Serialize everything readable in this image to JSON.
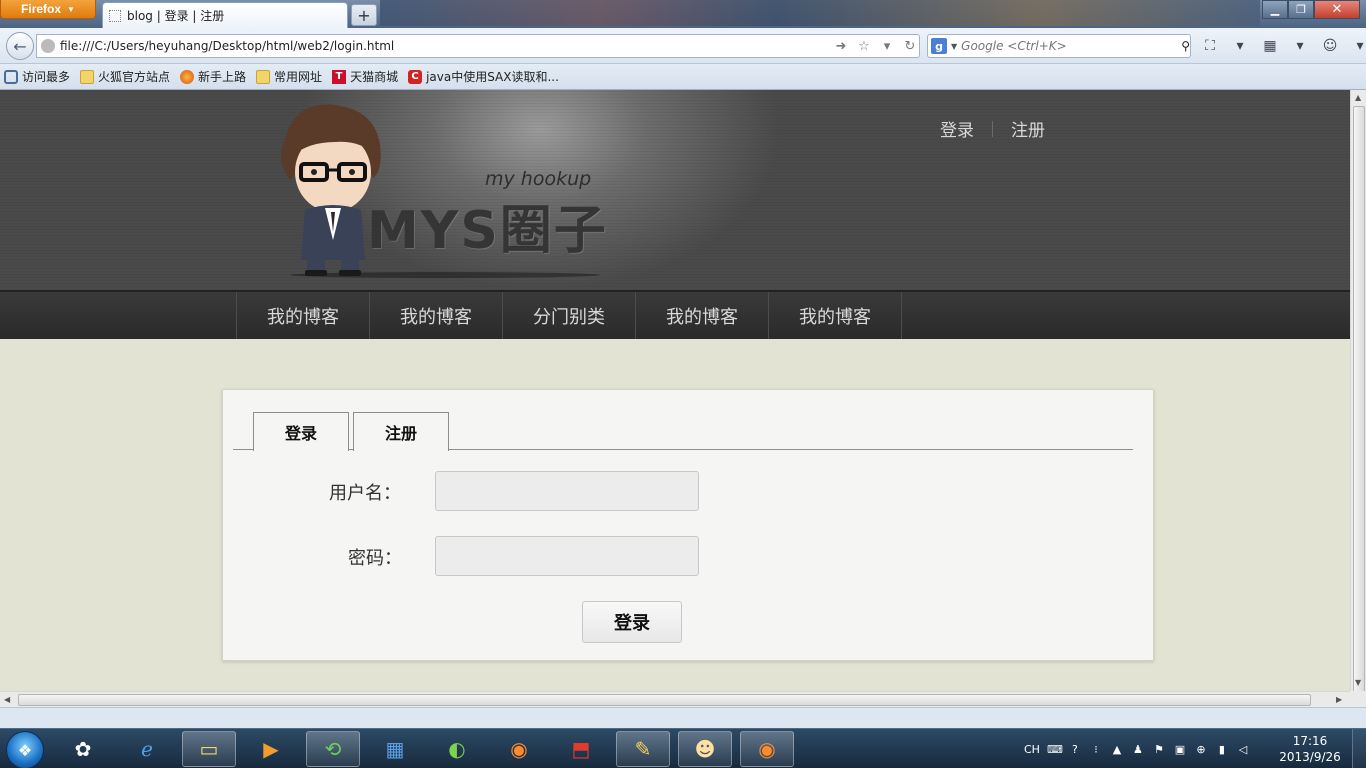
{
  "browser": {
    "menu_label": "Firefox",
    "tab_title": "blog | 登录 | 注册",
    "url": "file:///C:/Users/heyuhang/Desktop/html/web2/login.html",
    "search_placeholder": "Google <Ctrl+K>",
    "bookmarks": [
      "访问最多",
      "火狐官方站点",
      "新手上路",
      "常用网址",
      "天猫商城",
      "java中使用SAX读取和..."
    ]
  },
  "site": {
    "logo_tagline": "my hookup",
    "logo_text": "MYS圈子",
    "top_links": {
      "login": "登录",
      "register": "注册"
    },
    "nav": [
      "我的博客",
      "我的博客",
      "分门别类",
      "我的博客",
      "我的博客"
    ]
  },
  "login_form": {
    "tabs": {
      "login": "登录",
      "register": "注册"
    },
    "username_label": "用户名：",
    "password_label": "密码：",
    "submit_label": "登录"
  },
  "taskbar": {
    "language": "CH",
    "time": "17:16",
    "date": "2013/9/26"
  },
  "colors": {
    "page_bg": "#e2e3d2",
    "header_dark": "#4a4a4a",
    "nav_bg": "#2f2f2f",
    "firefox_orange": "#e17b0c"
  }
}
